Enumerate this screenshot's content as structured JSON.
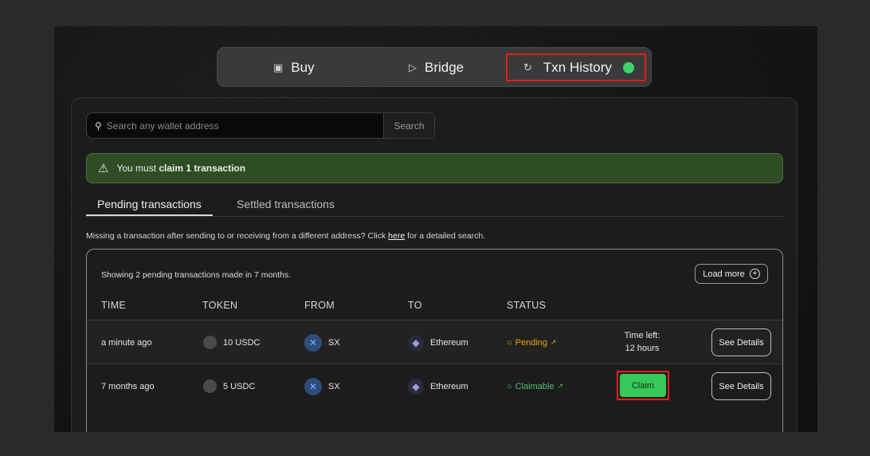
{
  "nav": {
    "buy": {
      "icon": "wallet-icon",
      "label": "Buy"
    },
    "bridge": {
      "icon": "send-icon",
      "label": "Bridge"
    },
    "txn": {
      "icon": "history-icon",
      "label": "Txn History"
    }
  },
  "search": {
    "placeholder": "Search any wallet address",
    "button": "Search"
  },
  "alert": {
    "prefix": "You must ",
    "bold": "claim 1 transaction",
    "icon": "warning-icon"
  },
  "tabs": {
    "pending": "Pending transactions",
    "settled": "Settled transactions"
  },
  "hint": {
    "before": "Missing a transaction after sending to or receiving from a different address? Click ",
    "link": "here",
    "after": " for a detailed search."
  },
  "panel": {
    "showing": "Showing 2 pending transactions made in 7 months.",
    "load_more": "Load more",
    "headers": {
      "time": "TIME",
      "token": "TOKEN",
      "from": "FROM",
      "to": "TO",
      "status": "STATUS"
    }
  },
  "rows": [
    {
      "time": "a minute ago",
      "token": "10 USDC",
      "from": "SX",
      "to": "Ethereum",
      "status": "Pending",
      "time_left_label": "Time left:",
      "time_left_value": "12 hours",
      "details": "See Details"
    },
    {
      "time": "7 months ago",
      "token": "5 USDC",
      "from": "SX",
      "to": "Ethereum",
      "status": "Claimable",
      "claim": "Claim",
      "details": "See Details"
    }
  ],
  "colors": {
    "accent_green": "#36c95a",
    "pending": "#e8a317",
    "alert_bg": "#2e4d25",
    "highlight": "#e0201c"
  }
}
